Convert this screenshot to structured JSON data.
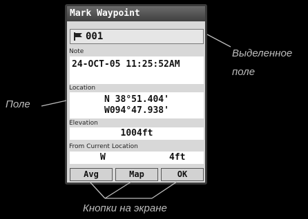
{
  "window": {
    "title": "Mark Waypoint"
  },
  "waypoint": {
    "name": "001",
    "icon": "flag-icon"
  },
  "note": {
    "label": "Note",
    "value": "24-OCT-05 11:25:52AM"
  },
  "location": {
    "label": "Location",
    "line1": "N  38°51.404'",
    "line2": "W094°47.938'"
  },
  "elevation": {
    "label": "Elevation",
    "value": "1004ft"
  },
  "from_current": {
    "label": "From Current Location",
    "bearing": "W",
    "distance": "4ft"
  },
  "buttons": {
    "avg": "Avg",
    "map": "Map",
    "ok": "OK"
  },
  "annotations": {
    "highlighted_field": "Выделенное поле",
    "field": "Поле",
    "screen_buttons": "Кнопки на экране"
  }
}
